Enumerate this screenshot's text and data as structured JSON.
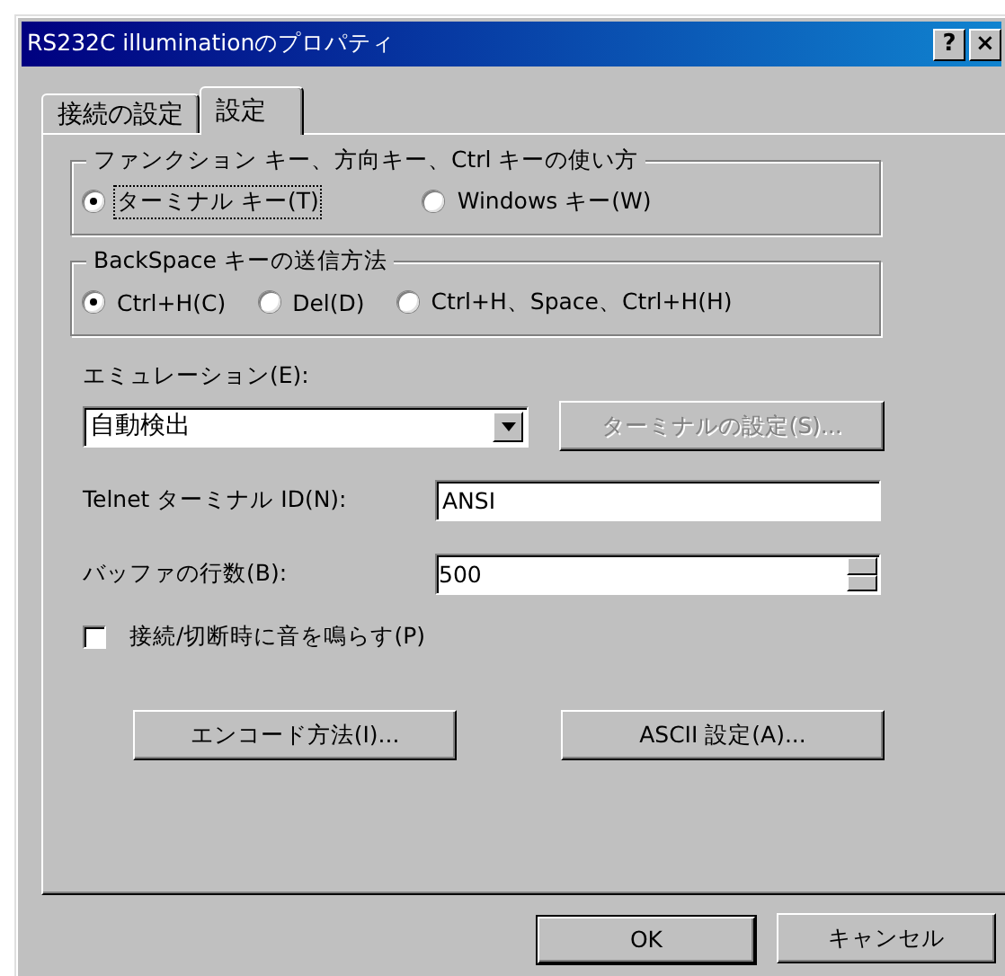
{
  "window": {
    "title": "RS232C illuminationのプロパティ",
    "title_buttons": [
      "?",
      "×"
    ]
  },
  "tabs": [
    {
      "label": "接続の設定",
      "selected": false
    },
    {
      "label": "設定",
      "selected": true
    }
  ],
  "groups": [
    {
      "title": "ファンクション キー、方向キー、Ctrl キーの使い方",
      "options": [
        {
          "label": "ターミナル キー(T)",
          "selected": true,
          "focused": true
        },
        {
          "label": "Windows キー(W)",
          "selected": false,
          "focused": false
        }
      ]
    },
    {
      "title": "BackSpace キーの送信方法",
      "options": [
        {
          "label": "Ctrl+H(C)",
          "selected": true,
          "focused": false
        },
        {
          "label": "Del(D)",
          "selected": false,
          "focused": false
        },
        {
          "label": "Ctrl+H、Space、Ctrl+H(H)",
          "selected": false,
          "focused": false
        }
      ]
    }
  ],
  "emulation": {
    "label": "エミュレーション(E):",
    "value": "自動検出",
    "settings_button": {
      "label": "ターミナルの設定(S)...",
      "disabled": true
    }
  },
  "telnet_id": {
    "label": "Telnet ターミナル ID(N):",
    "value": "ANSI"
  },
  "buffer_lines": {
    "label": "バッファの行数(B):",
    "value": "500"
  },
  "beep_checkbox": {
    "label": "接続/切断時に音を鳴らす(P)",
    "checked": false
  },
  "panel_buttons": [
    {
      "label": "エンコード方法(I)..."
    },
    {
      "label": "ASCII 設定(A)..."
    }
  ],
  "dialog_buttons": [
    {
      "label": "OK",
      "default": true
    },
    {
      "label": "キャンセル",
      "default": false
    }
  ]
}
